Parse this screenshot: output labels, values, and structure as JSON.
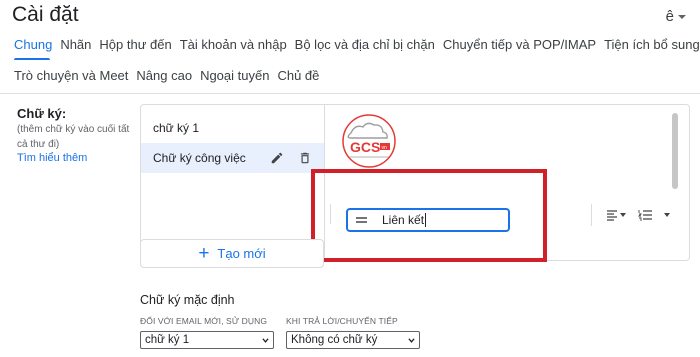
{
  "header": {
    "title": "Cài đặt",
    "language": "ê"
  },
  "tabs": {
    "row1": [
      "Chung",
      "Nhãn",
      "Hộp thư đến",
      "Tài khoản và nhập",
      "Bộ lọc và địa chỉ bị chặn",
      "Chuyển tiếp và POP/IMAP",
      "Tiện ích bổ sung"
    ],
    "row2": [
      "Trò chuyện và Meet",
      "Nâng cao",
      "Ngoại tuyến",
      "Chủ đề"
    ],
    "active": "Chung"
  },
  "signature": {
    "label": "Chữ ký:",
    "sublabel": "(thêm chữ ký vào cuối tất cả thư đi)",
    "learn_more": "Tìm hiểu thêm",
    "items": [
      {
        "label": "chữ ký 1"
      },
      {
        "label": "Chữ ký công việc"
      }
    ],
    "new_button": "Tạo mới",
    "logo_text": "GCS",
    "logo_suffix": "vn",
    "link_input_value": "Liên kết"
  },
  "defaults": {
    "title": "Chữ ký mặc định",
    "new_email_label": "ĐỐI VỚI EMAIL MỚI, SỬ DỤNG",
    "new_email_value": "chữ ký 1",
    "reply_label": "KHI TRẢ LỜI/CHUYỂN TIẾP",
    "reply_value": "Không có chữ ký"
  },
  "colors": {
    "accent": "#1a73e8",
    "highlight": "#d0202a",
    "logo_red": "#e53935"
  },
  "icons": [
    "chevron-down-icon",
    "pencil-icon",
    "trash-icon",
    "plus-icon",
    "align-icon",
    "numbered-list-icon",
    "more-icon",
    "text-lines-icon"
  ]
}
